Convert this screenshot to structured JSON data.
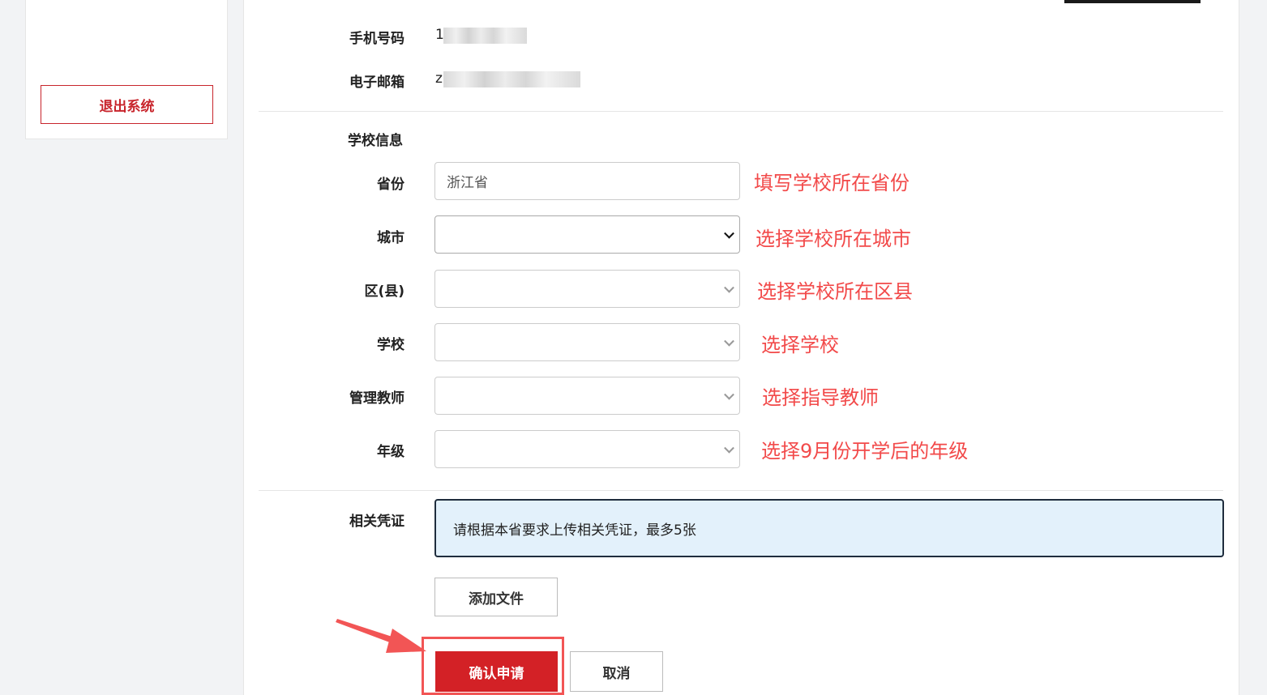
{
  "sidebar": {
    "logout_label": "退出系统"
  },
  "contact": {
    "phone_label": "手机号码",
    "phone_value_visible": "1",
    "email_label": "电子邮箱",
    "email_value_visible": "z"
  },
  "school": {
    "section_label": "学校信息",
    "fields": [
      {
        "label": "省份",
        "value": "浙江省",
        "hint": "填写学校所在省份",
        "type": "text"
      },
      {
        "label": "城市",
        "value": "",
        "hint": "选择学校所在城市",
        "type": "select"
      },
      {
        "label": "区(县)",
        "value": "",
        "hint": "选择学校所在区县",
        "type": "select"
      },
      {
        "label": "学校",
        "value": "",
        "hint": "选择学校",
        "type": "select"
      },
      {
        "label": "管理教师",
        "value": "",
        "hint": "选择指导教师",
        "type": "select"
      },
      {
        "label": "年级",
        "value": "",
        "hint": "选择9月份开学后的年级",
        "type": "select"
      }
    ]
  },
  "credentials": {
    "label": "相关凭证",
    "notice": "请根据本省要求上传相关凭证，最多5张",
    "add_file_label": "添加文件"
  },
  "actions": {
    "confirm_label": "确认申请",
    "cancel_label": "取消"
  },
  "colors": {
    "accent_red": "#d32126",
    "hint_red": "#f24a4a",
    "notice_bg": "#e3f1fb"
  }
}
